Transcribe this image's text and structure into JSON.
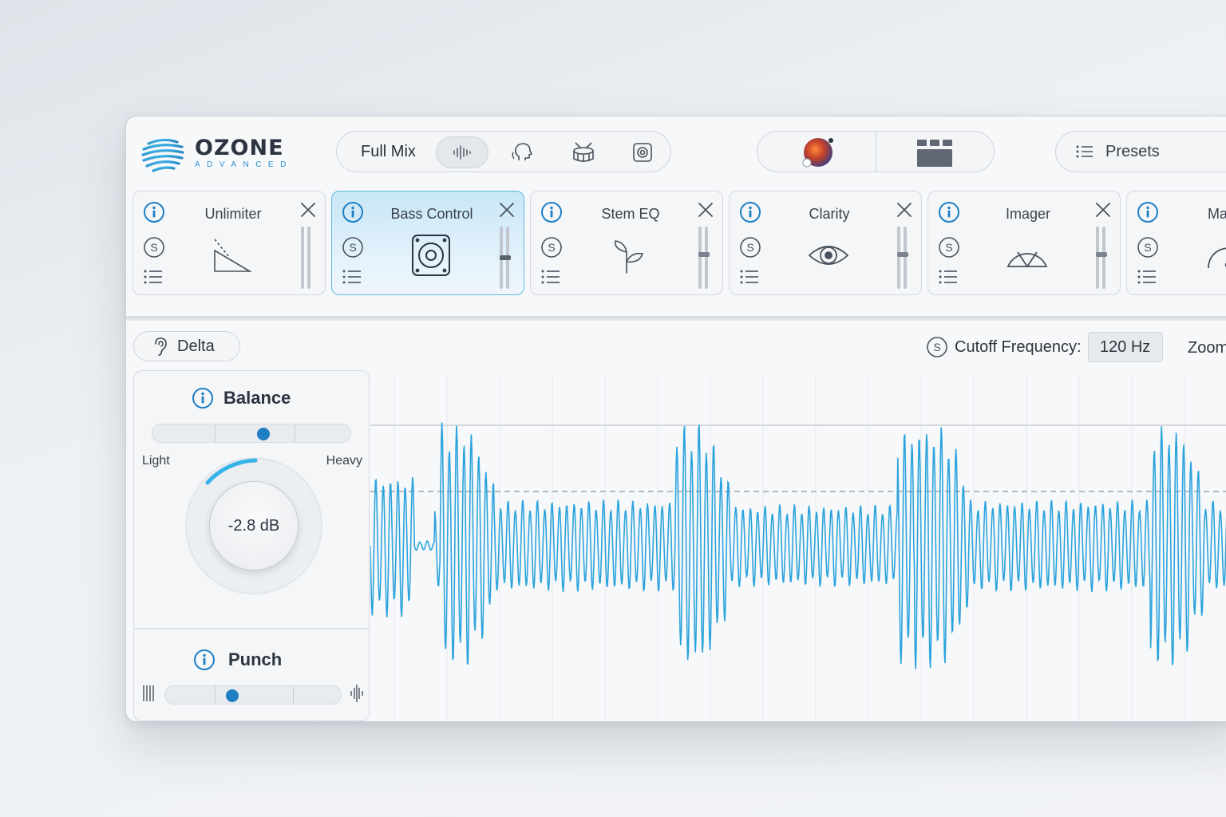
{
  "app": {
    "logo_title": "OZONE",
    "logo_subtitle": "ADVANCED"
  },
  "source": {
    "label": "Full Mix",
    "buttons": [
      "waveform-icon",
      "vocal-head-icon",
      "drum-icon",
      "bass-speaker-icon"
    ],
    "active_index": 0
  },
  "presets": {
    "label": "Presets"
  },
  "modules": [
    {
      "name": "Unlimiter",
      "icon": "unlimiter-icon",
      "active": false
    },
    {
      "name": "Bass Control",
      "icon": "speaker-icon",
      "active": true
    },
    {
      "name": "Stem EQ",
      "icon": "sprout-icon",
      "active": false
    },
    {
      "name": "Clarity",
      "icon": "eye-icon",
      "active": false
    },
    {
      "name": "Imager",
      "icon": "imager-icon",
      "active": false
    },
    {
      "name": "Maxin",
      "icon": "gauge-icon",
      "active": false
    }
  ],
  "controls": {
    "delta_label": "Delta",
    "cutoff_label": "Cutoff Frequency:",
    "cutoff_value": "120 Hz",
    "zoom_label": "Zoom"
  },
  "balance": {
    "title": "Balance",
    "left_label": "Light",
    "right_label": "Heavy",
    "slider_position": 0.56,
    "knob_value": "-2.8 dB"
  },
  "punch": {
    "title": "Punch",
    "slider_position": 0.38
  },
  "colors": {
    "accent": "#2a9fd8",
    "waveform": "#2ba3dc",
    "active_module": "#c8e6f6"
  }
}
